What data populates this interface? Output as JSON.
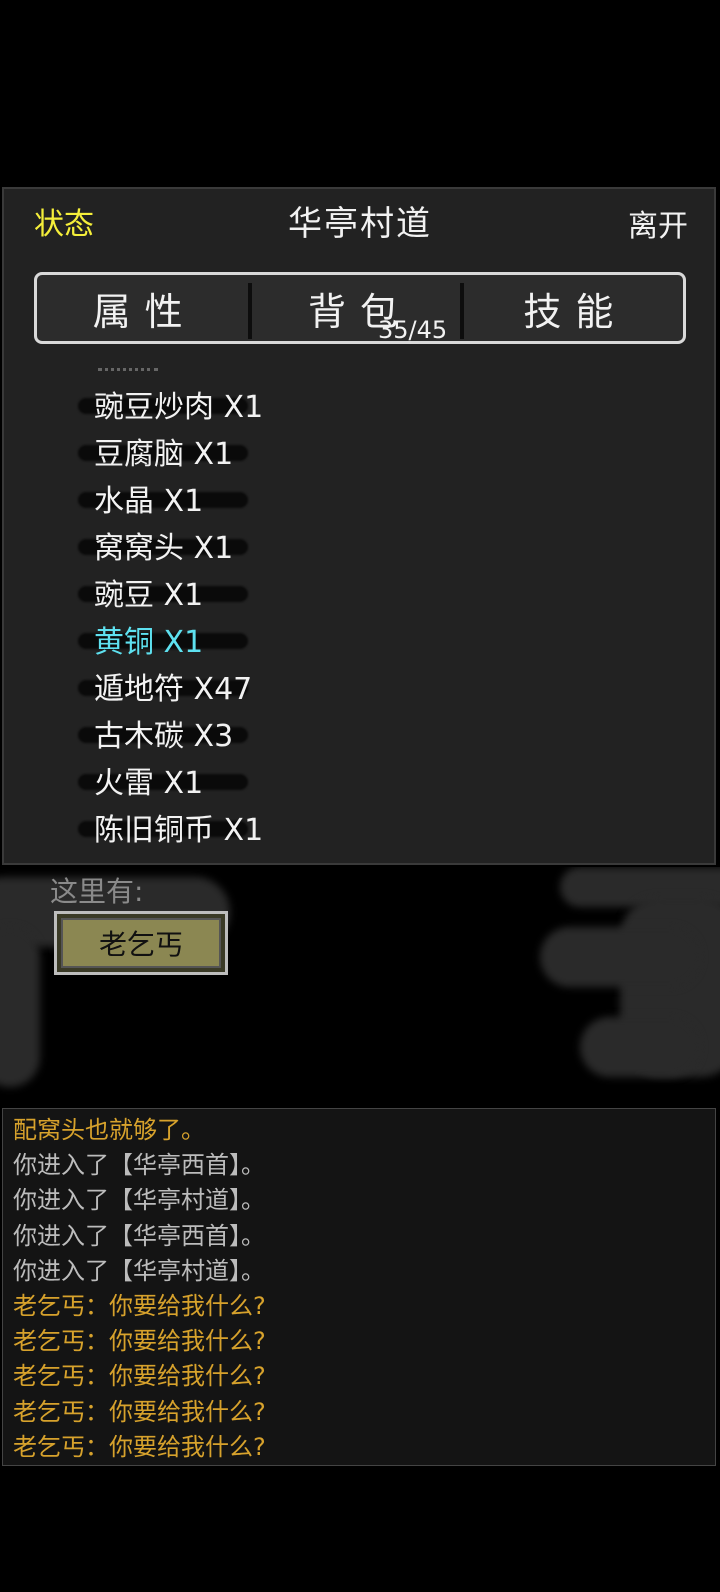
{
  "header": {
    "left_label": "状态",
    "title": "华亭村道",
    "right_label": "离开"
  },
  "tabs": [
    {
      "label": "属性"
    },
    {
      "label": "背包"
    },
    {
      "label": "技能"
    }
  ],
  "inventory_count": "35/45",
  "inventory": [
    {
      "label": "豌豆炒肉 X1",
      "selected": false
    },
    {
      "label": "豆腐脑 X1",
      "selected": false
    },
    {
      "label": "水晶 X1",
      "selected": false
    },
    {
      "label": "窝窝头 X1",
      "selected": false
    },
    {
      "label": "豌豆 X1",
      "selected": false
    },
    {
      "label": "黄铜 X1",
      "selected": true
    },
    {
      "label": "遁地符 X47",
      "selected": false
    },
    {
      "label": "古木碳 X3",
      "selected": false
    },
    {
      "label": "火雷 X1",
      "selected": false
    },
    {
      "label": "陈旧铜币 X1",
      "selected": false
    }
  ],
  "here": {
    "label": "这里有:",
    "npc": "老乞丐"
  },
  "log": [
    {
      "text": "配窝头也就够了。",
      "color": "gold"
    },
    {
      "text": "你进入了【华亭西首】。",
      "color": "gray"
    },
    {
      "text": "你进入了【华亭村道】。",
      "color": "gray"
    },
    {
      "text": "你进入了【华亭西首】。",
      "color": "gray"
    },
    {
      "text": "你进入了【华亭村道】。",
      "color": "gray"
    },
    {
      "text": "老乞丐：你要给我什么?",
      "color": "gold"
    },
    {
      "text": "老乞丐：你要给我什么?",
      "color": "gold"
    },
    {
      "text": "老乞丐：你要给我什么?",
      "color": "gold"
    },
    {
      "text": "老乞丐：你要给我什么?",
      "color": "gold"
    },
    {
      "text": "老乞丐：你要给我什么?",
      "color": "gold"
    }
  ]
}
